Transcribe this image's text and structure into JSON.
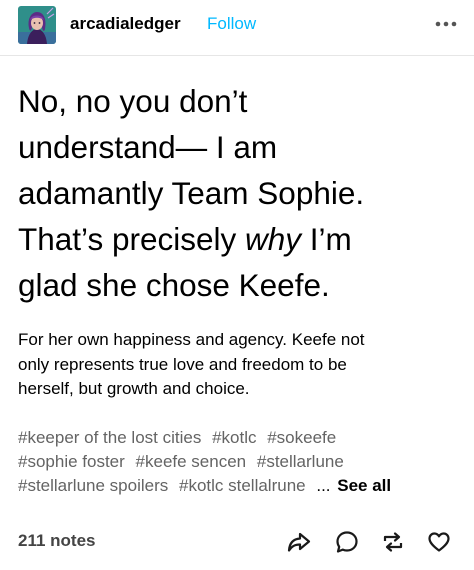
{
  "post": {
    "username": "arcadialedger",
    "follow_label": "Follow",
    "heading_lines": [
      {
        "before": "No, no you don’t",
        "emph": "",
        "after": ""
      },
      {
        "before": "understand— I am",
        "emph": "",
        "after": ""
      },
      {
        "before": "adamantly Team Sophie.",
        "emph": "",
        "after": ""
      },
      {
        "before": "That’s precisely ",
        "emph": "why",
        "after": " I’m"
      },
      {
        "before": "glad she chose Keefe.",
        "emph": "",
        "after": ""
      }
    ],
    "body_lines": [
      "For her own happiness and agency. Keefe not",
      "only represents true love and freedom to be",
      "herself, but growth and choice."
    ],
    "tag_rows": [
      [
        "#keeper of the lost cities",
        "#kotlc",
        "#sokeefe"
      ],
      [
        "#sophie foster",
        "#keefe sencen",
        "#stellarlune"
      ],
      [
        "#stellarlune spoilers",
        "#kotlc stellalrune"
      ]
    ],
    "tags_ellipsis": "...",
    "see_all_label": "See all",
    "notes_label": "211 notes"
  },
  "icons": {
    "avatar": "avatar-icon",
    "more": "more-options-icon",
    "share": "share-icon",
    "reply": "reply-icon",
    "reblog": "reblog-icon",
    "like": "heart-icon"
  },
  "colors": {
    "follow": "#00b8ff",
    "tag": "#646464",
    "notes": "#444444",
    "divider": "#e6e6e6"
  }
}
